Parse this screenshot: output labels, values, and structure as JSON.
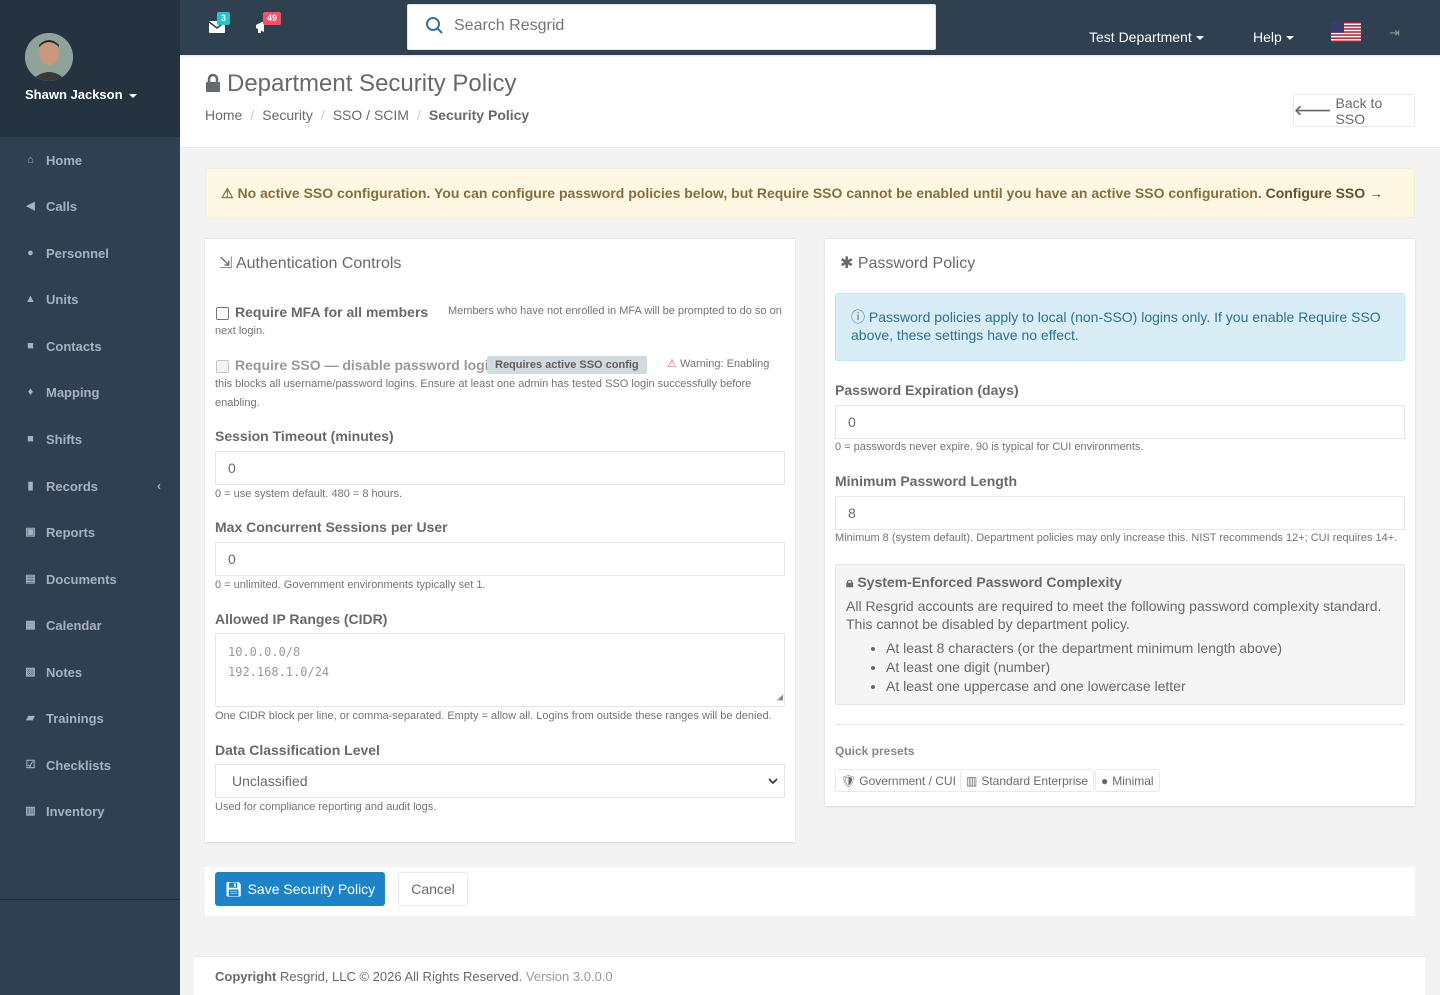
{
  "user": {
    "name": "Shawn Jackson"
  },
  "sidebar": {
    "items": [
      {
        "label": "Home",
        "icon": "home-icon"
      },
      {
        "label": "Calls",
        "icon": "bullhorn-icon"
      },
      {
        "label": "Personnel",
        "icon": "user-icon"
      },
      {
        "label": "Units",
        "icon": "truck-icon"
      },
      {
        "label": "Contacts",
        "icon": "address-book-icon"
      },
      {
        "label": "Mapping",
        "icon": "map-marker-icon"
      },
      {
        "label": "Shifts",
        "icon": "briefcase-icon"
      },
      {
        "label": "Records",
        "icon": "file-icon"
      },
      {
        "label": "Reports",
        "icon": "reports-icon"
      },
      {
        "label": "Documents",
        "icon": "documents-icon"
      },
      {
        "label": "Calendar",
        "icon": "calendar-icon"
      },
      {
        "label": "Notes",
        "icon": "notes-icon"
      },
      {
        "label": "Trainings",
        "icon": "trainings-icon"
      },
      {
        "label": "Checklists",
        "icon": "checklist-icon"
      },
      {
        "label": "Inventory",
        "icon": "inventory-icon"
      }
    ]
  },
  "topbar": {
    "messages_count": "3",
    "calls_count": "49",
    "search_placeholder": "Search Resgrid",
    "department": "Test Department",
    "help": "Help"
  },
  "page": {
    "title": "Department Security Policy",
    "breadcrumb": [
      "Home",
      "Security",
      "SSO / SCIM",
      "Security Policy"
    ],
    "back_label": "Back to SSO"
  },
  "alert": {
    "text": "No active SSO configuration. You can configure password policies below, but Require SSO cannot be enabled until you have an active SSO configuration.",
    "link": "Configure SSO →"
  },
  "auth": {
    "title": "Authentication Controls",
    "mfa_label": "Require MFA for all members",
    "mfa_help_1": "Members who have not enrolled in MFA will be prompted to do so on",
    "mfa_help_2": "next login.",
    "sso_label": "Require SSO — disable password login",
    "sso_badge": "Requires active SSO config",
    "sso_warning_1": "Warning: Enabling",
    "sso_warning_2": "this blocks all username/password logins. Ensure at least one admin has tested SSO login successfully before",
    "sso_warning_3": "enabling.",
    "timeout_label": "Session Timeout (minutes)",
    "timeout_value": "0",
    "timeout_help": "0 = use system default. 480 = 8 hours.",
    "sessions_label": "Max Concurrent Sessions per User",
    "sessions_value": "0",
    "sessions_help": "0 = unlimited. Government environments typically set 1.",
    "ip_label": "Allowed IP Ranges (CIDR)",
    "ip_placeholder_1": "10.0.0.0/8",
    "ip_placeholder_2": "192.168.1.0/24",
    "ip_help": "One CIDR block per line, or comma-separated. Empty = allow all. Logins from outside these ranges will be denied.",
    "classification_label": "Data Classification Level",
    "classification_value": "Unclassified",
    "classification_help": "Used for compliance reporting and audit logs."
  },
  "password": {
    "title": "Password Policy",
    "info": "Password policies apply to local (non-SSO) logins only. If you enable Require SSO above, these settings have no effect.",
    "expiration_label": "Password Expiration (days)",
    "expiration_value": "0",
    "expiration_help": "0 = passwords never expire. 90 is typical for CUI environments.",
    "min_length_label": "Minimum Password Length",
    "min_length_value": "8",
    "min_length_help": "Minimum 8 (system default). Department policies may only increase this. NIST recommends 12+; CUI requires 14+.",
    "complexity_title": "System-Enforced Password Complexity",
    "complexity_desc": "All Resgrid accounts are required to meet the following password complexity standard. This cannot be disabled by department policy.",
    "complexity_rules": [
      "At least 8 characters (or the department minimum length above)",
      "At least one digit (number)",
      "At least one uppercase and one lowercase letter"
    ],
    "presets_label": "Quick presets",
    "presets": [
      "Government / CUI",
      "Standard Enterprise",
      "Minimal"
    ]
  },
  "actions": {
    "save": "Save Security Policy",
    "cancel": "Cancel"
  },
  "footer": {
    "copyright": "Copyright",
    "company": "Resgrid, LLC © 2026 All Rights Reserved.",
    "version": "Version 3.0.0.0"
  },
  "colors": {
    "sidebar": "#2f4050",
    "primary": "#1c84c6",
    "warning_bg": "#fcf8e3",
    "info_bg": "#d9edf7"
  }
}
